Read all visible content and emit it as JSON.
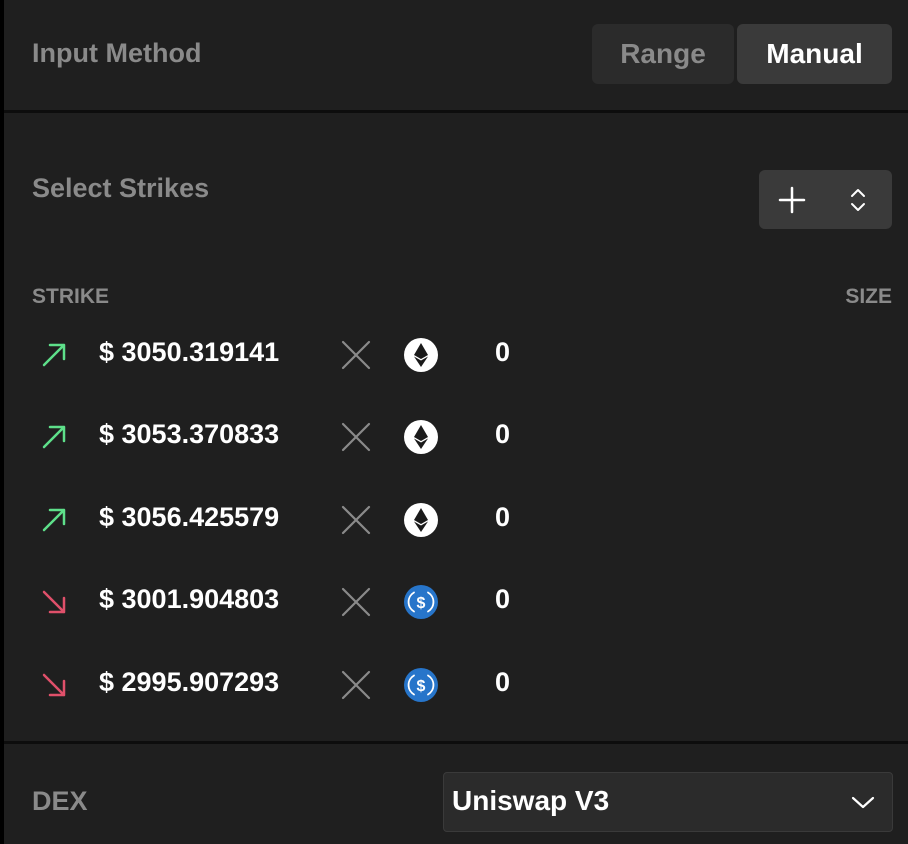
{
  "input_method": {
    "label": "Input Method",
    "options": [
      "Range",
      "Manual"
    ],
    "selected": "Manual"
  },
  "strikes": {
    "label": "Select Strikes",
    "add_icon": "plus-icon",
    "sort_icon": "chevron-up-down-icon",
    "columns": {
      "strike": "STRIKE",
      "size": "SIZE"
    },
    "rows": [
      {
        "direction": "up",
        "price": "$ 3050.319141",
        "token": "eth",
        "size": "0"
      },
      {
        "direction": "up",
        "price": "$ 3053.370833",
        "token": "eth",
        "size": "0"
      },
      {
        "direction": "up",
        "price": "$ 3056.425579",
        "token": "eth",
        "size": "0"
      },
      {
        "direction": "down",
        "price": "$ 3001.904803",
        "token": "usdc",
        "size": "0"
      },
      {
        "direction": "down",
        "price": "$ 2995.907293",
        "token": "usdc",
        "size": "0"
      }
    ]
  },
  "dex": {
    "label": "DEX",
    "selected": "Uniswap V3"
  },
  "colors": {
    "up_arrow": "#5ee08a",
    "down_arrow": "#e0506a",
    "usdc_blue": "#2775ca"
  }
}
